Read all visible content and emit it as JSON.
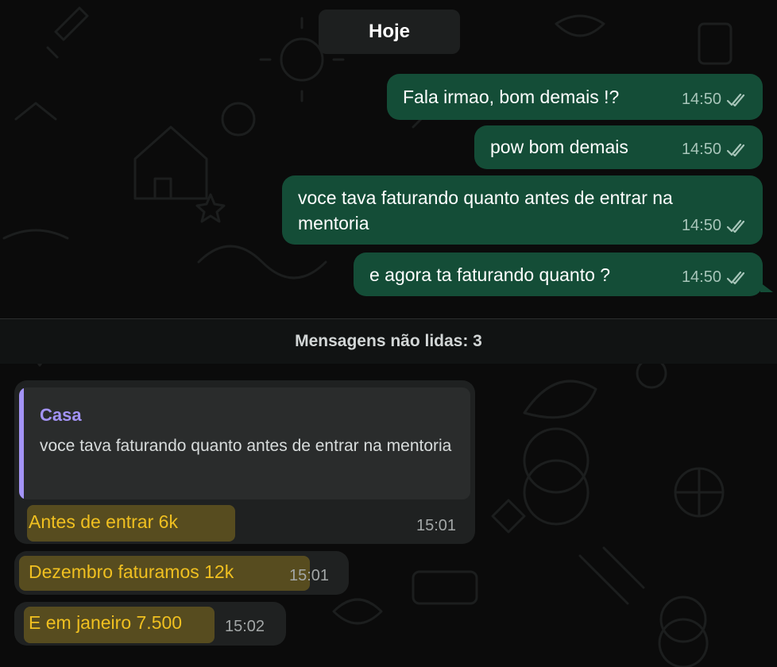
{
  "chat": {
    "date_label": "Hoje",
    "unread_label": "Mensagens não lidas: 3",
    "outgoing": [
      {
        "text": "Fala irmao, bom demais !?",
        "time": "14:50"
      },
      {
        "text": "pow bom demais",
        "time": "14:50"
      },
      {
        "text": "voce tava faturando quanto antes de entrar na",
        "text_line2": "mentoria",
        "time": "14:50"
      },
      {
        "text": "e agora ta faturando quanto ?",
        "time": "14:50"
      }
    ],
    "incoming": [
      {
        "reply_to": {
          "author": "Casa",
          "text": "voce tava faturando quanto antes de entrar na mentoria"
        },
        "text": "Antes de entrar 6k",
        "time": "15:01"
      },
      {
        "text": "Dezembro faturamos 12k",
        "time": "15:01"
      },
      {
        "text": "E em janeiro 7.500",
        "time": "15:02"
      }
    ]
  },
  "colors": {
    "outgoing_bubble": "#144d37",
    "incoming_bubble": "#1f2121",
    "reply_accent": "#a393f5",
    "highlight": "#f0c020",
    "background": "#0b0b0b"
  },
  "icons": {
    "read_receipt": "double-check-icon"
  }
}
